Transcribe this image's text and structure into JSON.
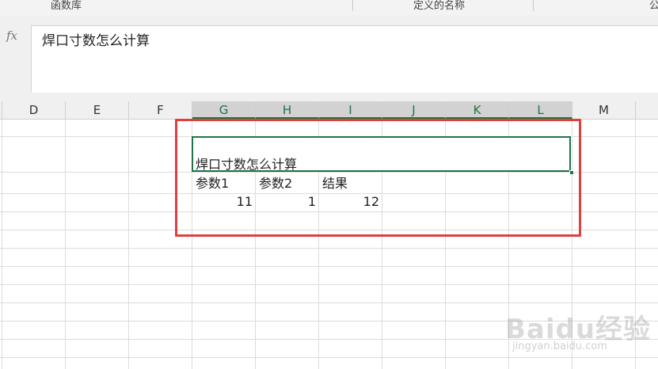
{
  "ribbon": {
    "group1_label": "函数库",
    "group2_label": "定义的名称",
    "group3_label": "公"
  },
  "formula_bar": {
    "fx_icon": "fx",
    "content": "焊口寸数怎么计算"
  },
  "columns": [
    "D",
    "E",
    "F",
    "G",
    "H",
    "I",
    "J",
    "K",
    "L",
    "M"
  ],
  "selected_columns": [
    "G",
    "H",
    "I",
    "J",
    "K",
    "L"
  ],
  "sheet": {
    "title_cell": "焊口寸数怎么计算",
    "headers": [
      "参数1",
      "参数2",
      "结果"
    ],
    "values": [
      "11",
      "1",
      "12"
    ]
  },
  "watermark": {
    "logo": "Baidu经验",
    "url": "jingyan.baidu.com"
  },
  "colors": {
    "selection": "#217346",
    "highlight_box": "#e0403c"
  }
}
